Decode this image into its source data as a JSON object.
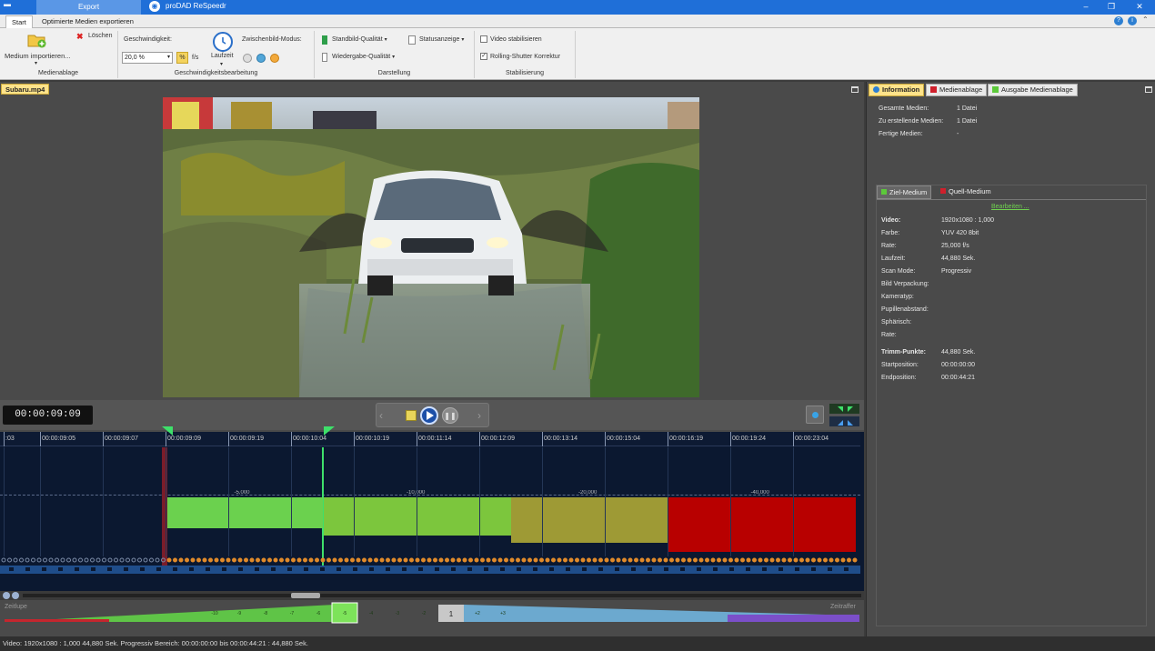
{
  "titlebar": {
    "export_tab": "Export",
    "app_title": "proDAD ReSpeedr"
  },
  "menu_tabs": [
    "Start",
    "Optimierte Medien exportieren"
  ],
  "ribbon": {
    "import_label": "Medium importieren...",
    "delete_label": "Löschen",
    "group_medienablage": "Medienablage",
    "speed_label": "Geschwindigkeit:",
    "speed_value": "20,0 %",
    "fps_label": "f/s",
    "runtime_label": "Laufzeit",
    "interframe_label": "Zwischenbild-Modus:",
    "group_speed": "Geschwindigkeitsbearbeitung",
    "still_quality": "Standbild-Qualität",
    "playback_quality": "Wiedergabe-Qualität",
    "status_display": "Statusanzeige",
    "group_display": "Darstellung",
    "stabilize_video": "Video stabilisieren",
    "rolling_shutter": "Rolling-Shutter Korrektur",
    "rolling_shutter_checked": true,
    "group_stabilization": "Stabilisierung"
  },
  "left": {
    "file_tab": "Subaru.mp4",
    "timecode": "00:00:09:09"
  },
  "timeline": {
    "ruler": [
      {
        "label": ":03",
        "pos": 6
      },
      {
        "label": "00:00:09:05",
        "pos": 46
      },
      {
        "label": "00:00:09:07",
        "pos": 115
      },
      {
        "label": "00:00:09:09",
        "pos": 184
      },
      {
        "label": "00:00:09:19",
        "pos": 253
      },
      {
        "label": "00:00:10:04",
        "pos": 322
      },
      {
        "label": "00:00:10:19",
        "pos": 391
      },
      {
        "label": "00:00:11:14",
        "pos": 460
      },
      {
        "label": "00:00:12:09",
        "pos": 529
      },
      {
        "label": "00:00:13:14",
        "pos": 598
      },
      {
        "label": "00:00:15:04",
        "pos": 667
      },
      {
        "label": "00:00:16:19",
        "pos": 736
      },
      {
        "label": "00:00:19:24",
        "pos": 805
      },
      {
        "label": "00:00:23:04",
        "pos": 874
      }
    ],
    "segments": [
      {
        "label": "-5,000",
        "color": "#6bd14e"
      },
      {
        "label": "-10,000",
        "color": "#7cc63d"
      },
      {
        "label": "-20,000",
        "color": "#9e9a35"
      },
      {
        "label": "-40,000",
        "color": "#b80000"
      }
    ]
  },
  "speedbar": {
    "left_label": "Zeitlupe",
    "right_label": "Zeitraffer",
    "values": [
      "-10",
      "-9",
      "-8",
      "-7",
      "-6",
      "-5",
      "-4",
      "-3",
      "-2",
      "1",
      "+2",
      "+3"
    ]
  },
  "right": {
    "tabs": [
      "Information",
      "Medienablage",
      "Ausgabe Medienablage"
    ],
    "summary": [
      {
        "label": "Gesamte Medien:",
        "value": "1 Datei"
      },
      {
        "label": "Zu erstellende Medien:",
        "value": "1 Datei"
      },
      {
        "label": "Fertige Medien:",
        "value": "-"
      }
    ],
    "subtabs": [
      "Ziel-Medium",
      "Quell-Medium"
    ],
    "edit_link": "Bearbeiten ...",
    "video_heading": "Video:",
    "video_rows": [
      {
        "label": "Video:",
        "value": "1920x1080 : 1,000"
      },
      {
        "label": "Farbe:",
        "value": "YUV 420 8bit"
      },
      {
        "label": "Rate:",
        "value": "25,000 f/s"
      },
      {
        "label": "Laufzeit:",
        "value": "44,880 Sek."
      },
      {
        "label": "Scan Mode:",
        "value": "Progressiv"
      },
      {
        "label": "Bild Verpackung:",
        "value": ""
      },
      {
        "label": "Kameratyp:",
        "value": ""
      },
      {
        "label": "Pupillenabstand:",
        "value": ""
      },
      {
        "label": "Sphärisch:",
        "value": ""
      },
      {
        "label": "Rate:",
        "value": ""
      }
    ],
    "trim_rows": [
      {
        "label": "Trimm-Punkte:",
        "value": "44,880 Sek."
      },
      {
        "label": "Startposition:",
        "value": "00:00:00:00"
      },
      {
        "label": "Endposition:",
        "value": "00:00:44:21"
      }
    ]
  },
  "statusbar": "Video: 1920x1080 : 1,000  44,880 Sek.  Progressiv  Bereich: 00:00:00:00 bis 00:00:44:21 : 44,880 Sek."
}
